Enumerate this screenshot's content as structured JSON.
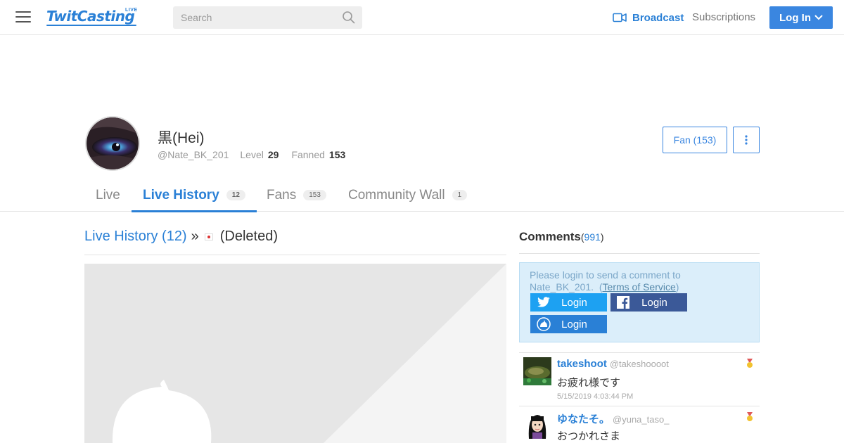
{
  "header": {
    "logo": "TwitCasting",
    "logo_live": "LIVE",
    "search_placeholder": "Search",
    "broadcast_label": "Broadcast",
    "subscriptions_label": "Subscriptions",
    "login_label": "Log In",
    "accent": "#2a80d6"
  },
  "profile": {
    "name": "黒(Hei)",
    "handle": "@Nate_BK_201",
    "level_label": "Level",
    "level": "29",
    "fanned_label": "Fanned",
    "fanned": "153",
    "fan_button": "Fan (153)"
  },
  "tabs": [
    {
      "label": "Live",
      "badge": ""
    },
    {
      "label": "Live History",
      "badge": "12"
    },
    {
      "label": "Fans",
      "badge": "153"
    },
    {
      "label": "Community Wall",
      "badge": "1"
    }
  ],
  "main": {
    "history_link": "Live History (12)",
    "separator": "»",
    "title": "(Deleted)"
  },
  "comments": {
    "title": "Comments",
    "open_paren": "(",
    "count": "991",
    "close_paren": ")",
    "login_prompt": "Please login to send a comment to Nate_BK_201.",
    "tos_open": "(",
    "tos": "Terms of Service",
    "tos_close": ")",
    "twitter_login": "Login",
    "facebook_login": "Login",
    "twitcasting_login": "Login",
    "items": [
      {
        "name": "takeshoot",
        "id": "@takeshoooot",
        "text": "お疲れ様です",
        "time": "5/15/2019 4:03:44 PM"
      },
      {
        "name": "ゆなたそ。",
        "id": "@yuna_taso_",
        "text": "おつかれさま",
        "time": ""
      }
    ]
  }
}
